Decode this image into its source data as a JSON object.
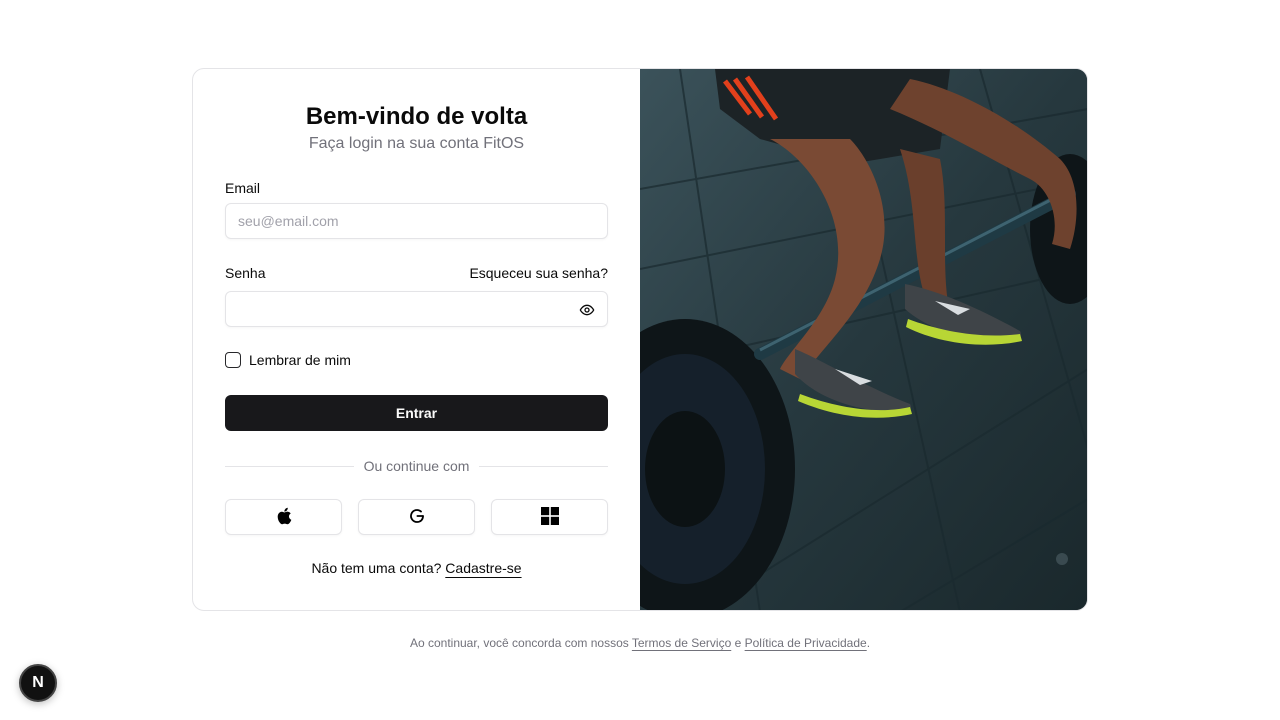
{
  "login": {
    "title": "Bem-vindo de volta",
    "subtitle": "Faça login na sua conta FitOS",
    "email_label": "Email",
    "email_placeholder": "seu@email.com",
    "email_value": "",
    "password_label": "Senha",
    "password_value": "",
    "forgot_label": "Esqueceu sua senha?",
    "remember_label": "Lembrar de mim",
    "remember_checked": false,
    "submit_label": "Entrar",
    "divider_text": "Ou continue com",
    "social": [
      {
        "icon": "apple-icon"
      },
      {
        "icon": "google-icon"
      },
      {
        "icon": "microsoft-icon"
      }
    ],
    "signup_prompt": "Não tem uma conta?",
    "signup_link": "Cadastre-se"
  },
  "footer": {
    "prefix": "Ao continuar, você concorda com nossos",
    "terms": "Termos de Serviço",
    "conjunction": "e",
    "privacy": "Política de Privacidade",
    "suffix": "."
  },
  "devtools": {
    "label": "N"
  },
  "colors": {
    "primary": "#18181b",
    "muted": "#71717a",
    "border": "#e4e4e7"
  }
}
